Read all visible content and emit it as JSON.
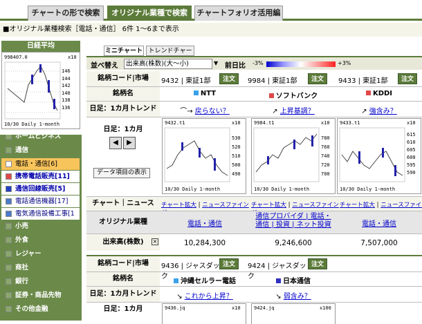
{
  "tabs": [
    "チャートの形で検索",
    "オリジナル業種で検索",
    "チャートフォリオ活用編"
  ],
  "subhead": "■オリジナル業種検索［電話・通信］ 6件 1〜6まで表示",
  "nikkei": {
    "title": "日経平均",
    "value": "998407.0",
    "unit": "x10",
    "ticks": [
      "146",
      "144",
      "142",
      "140",
      "138",
      "136"
    ],
    "footer": "10/30 Daily 1-month"
  },
  "menu": [
    {
      "label": "ホームビジネス",
      "type": "main"
    },
    {
      "label": "通信",
      "type": "main"
    },
    {
      "label": "電話・通信[6]",
      "type": "sel"
    },
    {
      "label": "携帯電話販売[11]",
      "type": "sub"
    },
    {
      "label": "通信回線販売[5]",
      "type": "sub"
    },
    {
      "label": "電話通信機器[17]",
      "type": "sub2"
    },
    {
      "label": "電気通信設備工事[1",
      "type": "sub2"
    },
    {
      "label": "小売",
      "type": "main"
    },
    {
      "label": "外食",
      "type": "main"
    },
    {
      "label": "レジャー",
      "type": "main"
    },
    {
      "label": "商社",
      "type": "main"
    },
    {
      "label": "銀行",
      "type": "main"
    },
    {
      "label": "証券・商品先物",
      "type": "main"
    },
    {
      "label": "その他金融",
      "type": "main"
    }
  ],
  "subtabs": [
    "ミニチャート",
    "トレンドチャート"
  ],
  "sort": {
    "label": "並べ替え",
    "value": "出来高(株数)(大〜小)",
    "prev": "前日比",
    "neg": "-3%",
    "pos": "+3%"
  },
  "labels": {
    "code": "銘柄コード|市場",
    "name": "銘柄名",
    "trend": "日足：1カ月トレンド",
    "daily": "日足：1カ月",
    "data_btn": "データ項目の表示",
    "chartnews": "チャート｜ニュース",
    "industry": "オリジナル業種",
    "volume": "出来高(株数)",
    "order": "注文"
  },
  "stocks": [
    {
      "code": "9432 | 東証1部",
      "name": "NTT",
      "trend": "戻らない？",
      "chart": "9432.t1",
      "unit": "x10",
      "ticks": [
        "530",
        "520",
        "510",
        "500",
        "490"
      ],
      "footer": "10/30 Daily 1-month",
      "industry": "電話・通信",
      "volume": "10,284,300",
      "color": "#3aa0e8"
    },
    {
      "code": "9984 | 東証1部",
      "name": "ソフトバンク",
      "trend": "上昇基調？",
      "chart": "9984.t1",
      "unit": "x10",
      "ticks": [
        "780",
        "760",
        "740",
        "720",
        "700"
      ],
      "footer": "10/30 Daily 1-month",
      "industry": "通信プロバイダ | 電話・通信 | 投資 | ネット投資",
      "volume": "9,246,600",
      "color": "#e04848"
    },
    {
      "code": "9433 | 東証1部",
      "name": "KDDI",
      "trend": "強含み？",
      "chart": "9433.t1",
      "unit": "x10",
      "ticks": [
        "615",
        "610",
        "605",
        "600",
        "595",
        "590"
      ],
      "footer": "10/30 Daily 1-month",
      "industry": "電話・通信",
      "volume": "7,507,000",
      "color": "#e04848"
    }
  ],
  "stocks2": [
    {
      "code": "9436 | ジャスダック",
      "name": "沖縄セルラー電話",
      "trend": "これから上昇？",
      "chart": "9436.jq",
      "unit": "x10",
      "color": "#3aa0e8"
    },
    {
      "code": "9424 | ジャスダック",
      "name": "日本通信",
      "trend": "弱含み？",
      "chart": "9424.jq",
      "unit": "x100",
      "color": "#3030c0"
    }
  ],
  "chart_links": [
    "チャート拡大",
    "ニュースファインダー"
  ]
}
